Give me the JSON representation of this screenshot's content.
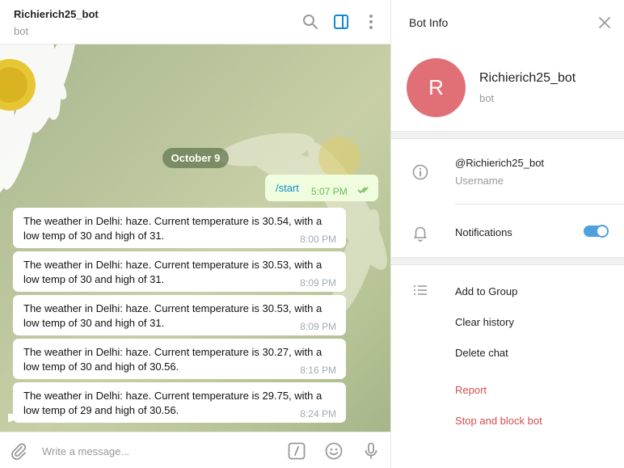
{
  "chat": {
    "title": "Richierich25_bot",
    "subtitle": "bot",
    "date_label": "October 9",
    "outgoing": {
      "text": "/start",
      "time": "5:07 PM"
    },
    "incoming": [
      {
        "text": "The weather in Delhi: haze. Current temperature is 30.54, with a low temp of 30 and high of 31.",
        "time": "8:00 PM"
      },
      {
        "text": "The weather in Delhi: haze. Current temperature is 30.53, with a low temp of 30 and high of 31.",
        "time": "8:09 PM"
      },
      {
        "text": "The weather in Delhi: haze. Current temperature is 30.53, with a low temp of 30 and high of 31.",
        "time": "8:09 PM"
      },
      {
        "text": "The weather in Delhi: haze. Current temperature is 30.27, with a low temp of 30 and high of 30.56.",
        "time": "8:16 PM"
      },
      {
        "text": "The weather in Delhi: haze. Current temperature is 29.75, with a low temp of 29 and high of 30.56.",
        "time": "8:24 PM"
      }
    ],
    "composer_placeholder": "Write a message..."
  },
  "icons": {
    "header": [
      "search-icon",
      "sidebar-toggle-icon",
      "more-vertical-icon"
    ],
    "composer": [
      "attach-icon",
      "bot-command-icon",
      "emoji-icon",
      "microphone-icon"
    ],
    "info": [
      "close-icon",
      "info-icon",
      "bell-icon",
      "list-icon"
    ]
  },
  "info": {
    "title": "Bot Info",
    "avatar_letter": "R",
    "name": "Richierich25_bot",
    "subtitle": "bot",
    "username": "@Richierich25_bot",
    "username_label": "Username",
    "notifications_label": "Notifications",
    "notifications_on": true,
    "actions": {
      "add_to_group": "Add to Group",
      "clear_history": "Clear history",
      "delete_chat": "Delete chat",
      "report": "Report",
      "stop_block": "Stop and block bot"
    }
  },
  "colors": {
    "accent": "#168acd",
    "toggle": "#4da1dc",
    "avatar": "#e17076",
    "danger": "#d14e4e",
    "outgoing_bubble": "#effdde"
  }
}
